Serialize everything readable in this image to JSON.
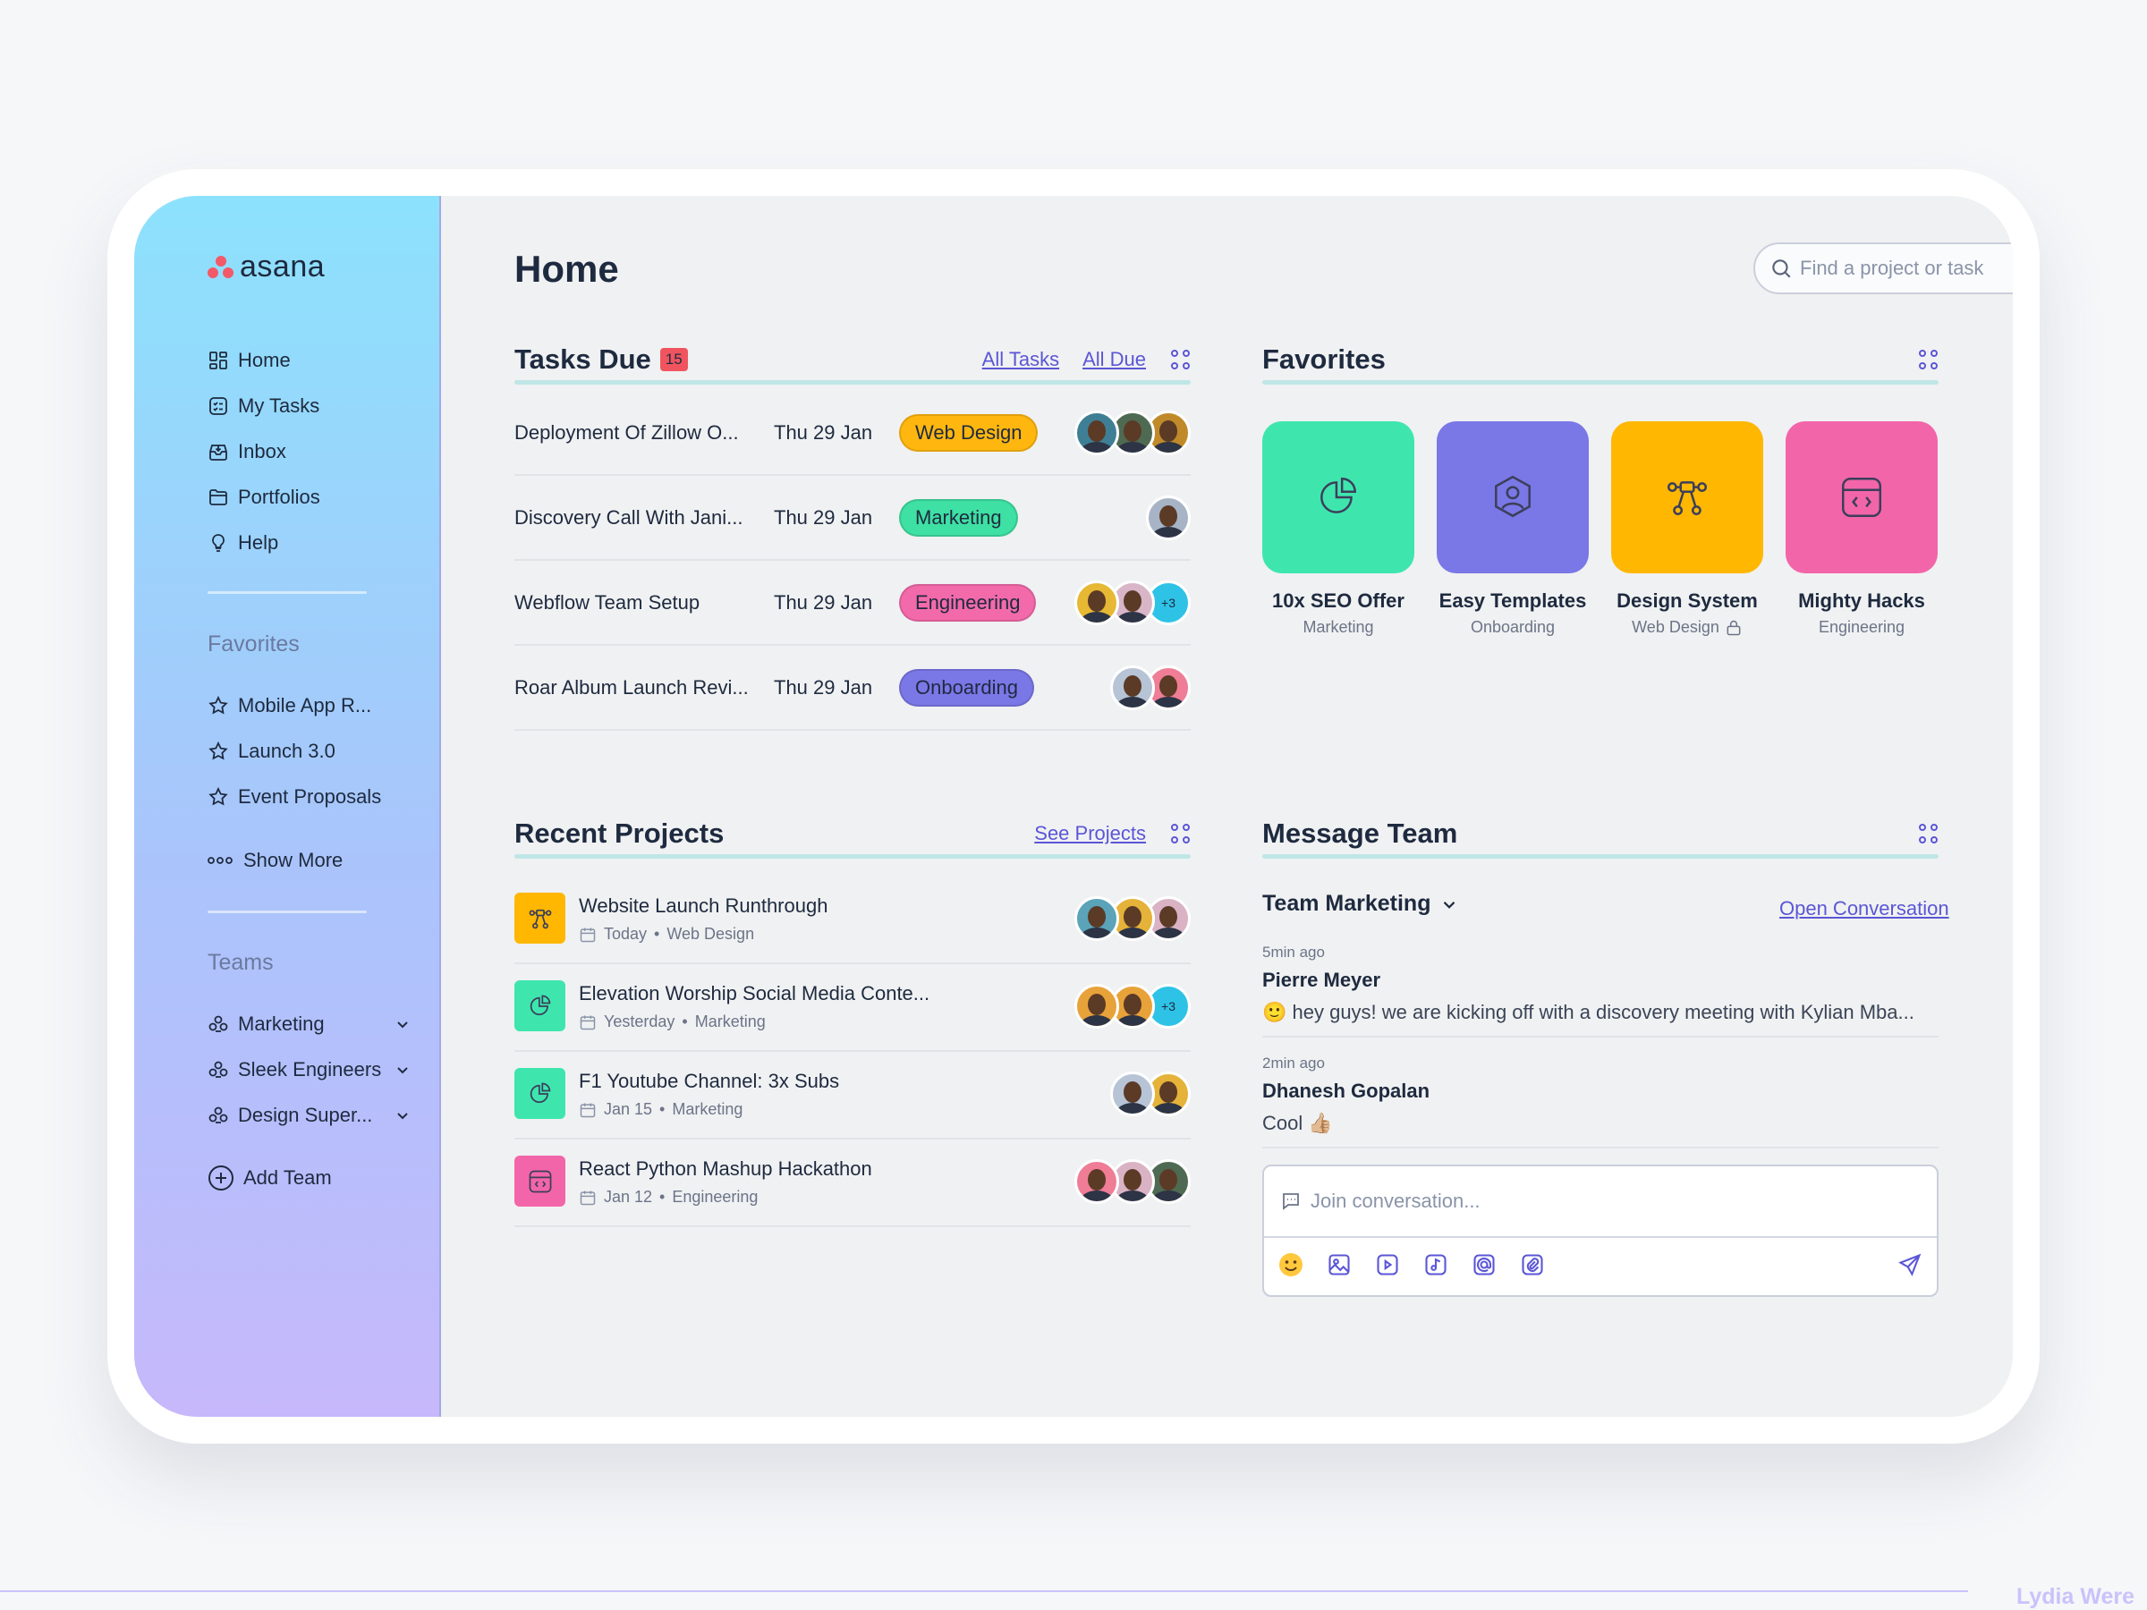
{
  "app": {
    "logo_text": "asana"
  },
  "sidebar": {
    "nav": [
      {
        "label": "Home",
        "icon": "dashboard-icon"
      },
      {
        "label": "My Tasks",
        "icon": "checklist-icon"
      },
      {
        "label": "Inbox",
        "icon": "inbox-icon"
      },
      {
        "label": "Portfolios",
        "icon": "folder-icon"
      },
      {
        "label": "Help",
        "icon": "lightbulb-icon"
      }
    ],
    "favorites_heading": "Favorites",
    "favorites": [
      "Mobile App R...",
      "Launch 3.0",
      "Event Proposals"
    ],
    "show_more": "Show More",
    "teams_heading": "Teams",
    "teams": [
      "Marketing",
      "Sleek Engineers",
      "Design Super..."
    ],
    "add_team": "Add Team"
  },
  "header": {
    "title": "Home",
    "search_placeholder": "Find a project or task"
  },
  "tasks": {
    "title": "Tasks Due",
    "count": "15",
    "all_tasks": "All Tasks",
    "all_due": "All Due",
    "rows": [
      {
        "name": "Deployment Of Zillow O...",
        "date": "Thu 29 Jan",
        "tag": "Web Design",
        "tag_color": "#ffb70f",
        "avatars": [
          "#3f7f96",
          "#4f6a52",
          "#c08a2a"
        ]
      },
      {
        "name": "Discovery Call With Jani...",
        "date": "Thu 29 Jan",
        "tag": "Marketing",
        "tag_color": "#3ee0a3",
        "avatars": [
          "#a7b4c6"
        ]
      },
      {
        "name": "Webflow Team Setup",
        "date": "Thu 29 Jan",
        "tag": "Engineering",
        "tag_color": "#f26aaa",
        "avatars": [
          "#e6b833",
          "#d8b6c8"
        ],
        "extra": "+3"
      },
      {
        "name": "Roar Album Launch Revi...",
        "date": "Thu 29 Jan",
        "tag": "Onboarding",
        "tag_color": "#7a77e6",
        "avatars": [
          "#b7c4d6",
          "#ef7d95"
        ]
      }
    ]
  },
  "favorites": {
    "title": "Favorites",
    "cards": [
      {
        "title": "10x SEO Offer",
        "sub": "Marketing",
        "color": "#3ee6ae",
        "icon": "pie-chart-icon"
      },
      {
        "title": "Easy Templates",
        "sub": "Onboarding",
        "color": "#7a77e6",
        "icon": "user-hexagon-icon"
      },
      {
        "title": "Design System",
        "sub": "Web Design",
        "color": "#ffb701",
        "icon": "flow-icon",
        "locked": true
      },
      {
        "title": "Mighty Hacks",
        "sub": "Engineering",
        "color": "#f365a9",
        "icon": "code-window-icon"
      }
    ]
  },
  "projects": {
    "title": "Recent Projects",
    "see_projects": "See Projects",
    "rows": [
      {
        "name": "Website Launch Runthrough",
        "when": "Today",
        "team": "Web Design",
        "color": "#ffb701",
        "avatars": [
          "#5aa3b8",
          "#e5b23a",
          "#d9b3c4"
        ]
      },
      {
        "name": "Elevation Worship Social Media Conte...",
        "when": "Yesterday",
        "team": "Marketing",
        "color": "#3ee6ae",
        "avatars": [
          "#e8a23a",
          "#e8a23a"
        ],
        "extra": "+3"
      },
      {
        "name": "F1 Youtube Channel: 3x Subs",
        "when": "Jan 15",
        "team": "Marketing",
        "color": "#3ee6ae",
        "avatars": [
          "#b7c4d6",
          "#e5b23a"
        ]
      },
      {
        "name": "React Python Mashup Hackathon",
        "when": "Jan 12",
        "team": "Engineering",
        "color": "#f365a9",
        "avatars": [
          "#ef7d95",
          "#d9b3c4",
          "#4f6a52"
        ]
      }
    ]
  },
  "messages": {
    "title": "Message Team",
    "team": "Team Marketing",
    "open": "Open Conversation",
    "items": [
      {
        "time": "5min ago",
        "author": "Pierre Meyer",
        "text": "🙂 hey guys! we are kicking off with a discovery meeting with Kylian Mba..."
      },
      {
        "time": "2min ago",
        "author": "Dhanesh Gopalan",
        "text": "Cool 👍🏼"
      }
    ],
    "composer_placeholder": "Join conversation..."
  },
  "watermark": "Lydia Were"
}
